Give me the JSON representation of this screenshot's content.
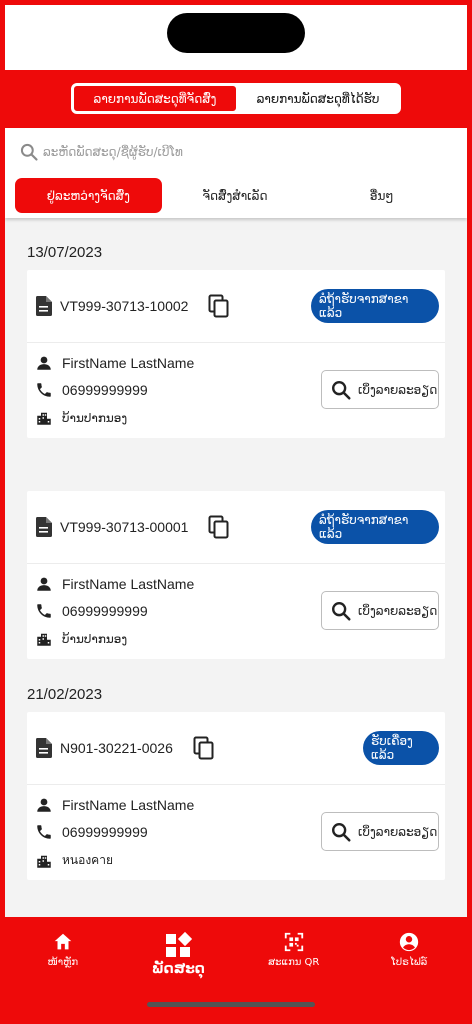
{
  "header_tabs": [
    "ລາຍການພັດສະດຸທີ່ຈັດສົ່ງ",
    "ລາຍການພັດສະດຸທີ່ໄດ້ຮັບ"
  ],
  "search": {
    "placeholder": "ລະຫັດພັດສະດຸ/ຊື່ຜູ້ຮັບ/ເບີໂທ"
  },
  "filter_tabs": [
    "ຢູ່ລະຫວ່າງຈັດສົ່ງ",
    "ຈັດສົ່ງສຳເລັດ",
    "ອື່ນໆ"
  ],
  "groups": [
    {
      "date": "13/07/2023",
      "cards": [
        {
          "code": "VT999-30713-10002",
          "status": "ລໍຖ້າຮັບຈາກສາຂາແລ້ວ",
          "name": "FirstName LastName",
          "phone": "06999999999",
          "address": "ບ້ານປາກນອງ",
          "detail": "ເບິ່ງລາຍລະອຽດ"
        },
        {
          "code": "VT999-30713-00001",
          "status": "ລໍຖ້າຮັບຈາກສາຂາແລ້ວ",
          "name": "FirstName LastName",
          "phone": "06999999999",
          "address": "ບ້ານປາກນອງ",
          "detail": "ເບິ່ງລາຍລະອຽດ"
        }
      ]
    },
    {
      "date": "21/02/2023",
      "cards": [
        {
          "code": "N901-30221-0026",
          "status": "ຮັບເຄື່ອງແລ້ວ",
          "name": "FirstName LastName",
          "phone": "06999999999",
          "address": "หนองคาย",
          "detail": "ເບິ່ງລາຍລະອຽດ"
        }
      ]
    }
  ],
  "bottom_nav": [
    {
      "label": "ໜ້າຫຼັກ",
      "icon": "home-icon"
    },
    {
      "label": "ພັດສະດຸ",
      "icon": "grid-icon"
    },
    {
      "label": "ສະແກນ QR",
      "icon": "qr-icon"
    },
    {
      "label": "ໂປຣໄຟລ໌",
      "icon": "account-icon"
    }
  ],
  "colors": {
    "brand_red": "#ee0a0a",
    "status_blue": "#0b52a8"
  }
}
